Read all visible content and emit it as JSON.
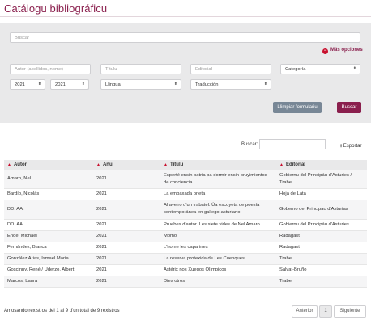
{
  "page": {
    "title": "Catálogu bibliográficu"
  },
  "filters": {
    "search_placeholder": "Buscar",
    "more_options": "Más opciones",
    "author_placeholder": "Autor (apellidos, nome)",
    "title_placeholder": "Títulu",
    "publisher_placeholder": "Editorial",
    "category": "Categoría",
    "year_from": "2021",
    "year_to": "2021",
    "language": "Llingua",
    "translation": "Traducción",
    "clear_button": "Llimpiar formulariu",
    "search_button": "Buscar"
  },
  "table_tools": {
    "search_label": "Buscar:",
    "export_label": "Esportar"
  },
  "table": {
    "headers": [
      "Autor",
      "Añu",
      "Títulu",
      "Editorial"
    ],
    "rows": [
      [
        "Amaro, Nel",
        "2021",
        "Esperté ensin patria pa dormir ensin pruyimientos de conciencia",
        "Gobiernu del Principáu d'Asturies / Trabe"
      ],
      [
        "Bardío, Nicolás",
        "2021",
        "La embaxada prieta",
        "Hoja de Lata"
      ],
      [
        "DD. AA.",
        "2021",
        "Al aveiro d'un trabatel. Ùa escoyeta de poesía contemporánea en gallego-asturiano",
        "Goberno del Principao d'Asturias"
      ],
      [
        "DD. AA.",
        "2021",
        "Pruebes d'autor. Les siete vides de Nel Amaro",
        "Gobiernu del Principáu d'Asturies"
      ],
      [
        "Ende, Michael",
        "2021",
        "Momo",
        "Radagast"
      ],
      [
        "Fernández, Blanca",
        "2021",
        "L'home les caparines",
        "Radagast"
      ],
      [
        "González Arias, Ismael María",
        "2021",
        "La reserva protexida de Les Cuenques",
        "Trabe"
      ],
      [
        "Goscinny, René / Uderzo, Albert",
        "2021",
        "Astérix nos Xuegos Olímpicos",
        "Salvat-Bruño"
      ],
      [
        "Marcos, Laura",
        "2021",
        "Dies otros",
        "Trabe"
      ]
    ]
  },
  "footer": {
    "info": "Amosando rexistros del 1 al 9 d'un total de 9 rexistros",
    "prev": "Anterior",
    "page": "1",
    "next": "Siguiente"
  }
}
